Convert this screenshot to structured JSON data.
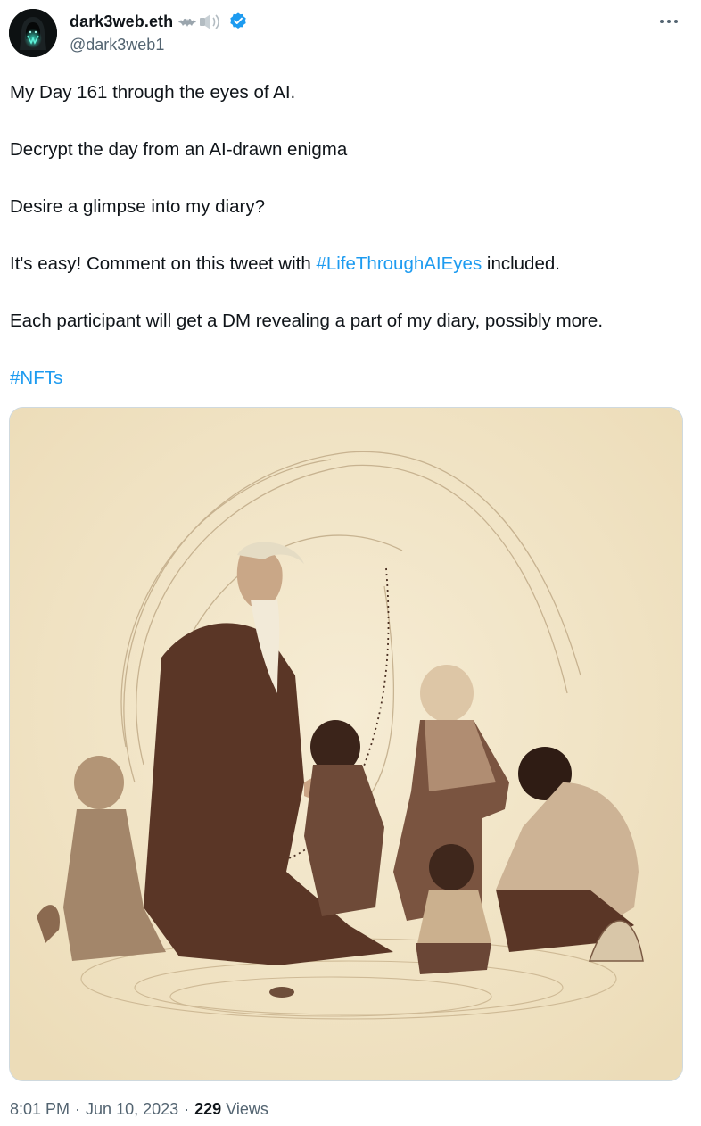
{
  "author": {
    "display_name": "dark3web.eth",
    "handle": "@dark3web1",
    "verified": true,
    "name_emoji": [
      "bat-emoji",
      "speaker-emoji"
    ],
    "avatar_icon": "hooded-figure-avatar"
  },
  "more_icon": "more-horizontal-icon",
  "tweet": {
    "paragraphs": [
      {
        "segments": [
          {
            "text": "My Day 161 through the eyes of AI."
          }
        ]
      },
      {
        "segments": [
          {
            "text": "Decrypt the day from an AI-drawn enigma"
          }
        ]
      },
      {
        "segments": [
          {
            "text": "Desire a glimpse into my diary?"
          }
        ]
      },
      {
        "segments": [
          {
            "text": "It's easy! Comment on this tweet with "
          },
          {
            "text": "#LifeThroughAIEyes",
            "hashtag": true
          },
          {
            "text": " included."
          }
        ]
      },
      {
        "segments": [
          {
            "text": "Each participant will get a DM revealing a part of my diary, possibly more."
          }
        ]
      },
      {
        "segments": [
          {
            "text": "#NFTs",
            "hashtag": true
          }
        ]
      }
    ],
    "image_icon": "sepia-illustration-family-elder-children"
  },
  "footer": {
    "time": "8:01 PM",
    "date": "Jun 10, 2023",
    "separator": "·",
    "views_count": "229",
    "views_label": "Views"
  },
  "colors": {
    "link": "#1d9bf0",
    "secondary_text": "#536471",
    "primary_text": "#0f1419",
    "image_background": "#f1e4c7",
    "sepia_dark": "#5a3626"
  }
}
